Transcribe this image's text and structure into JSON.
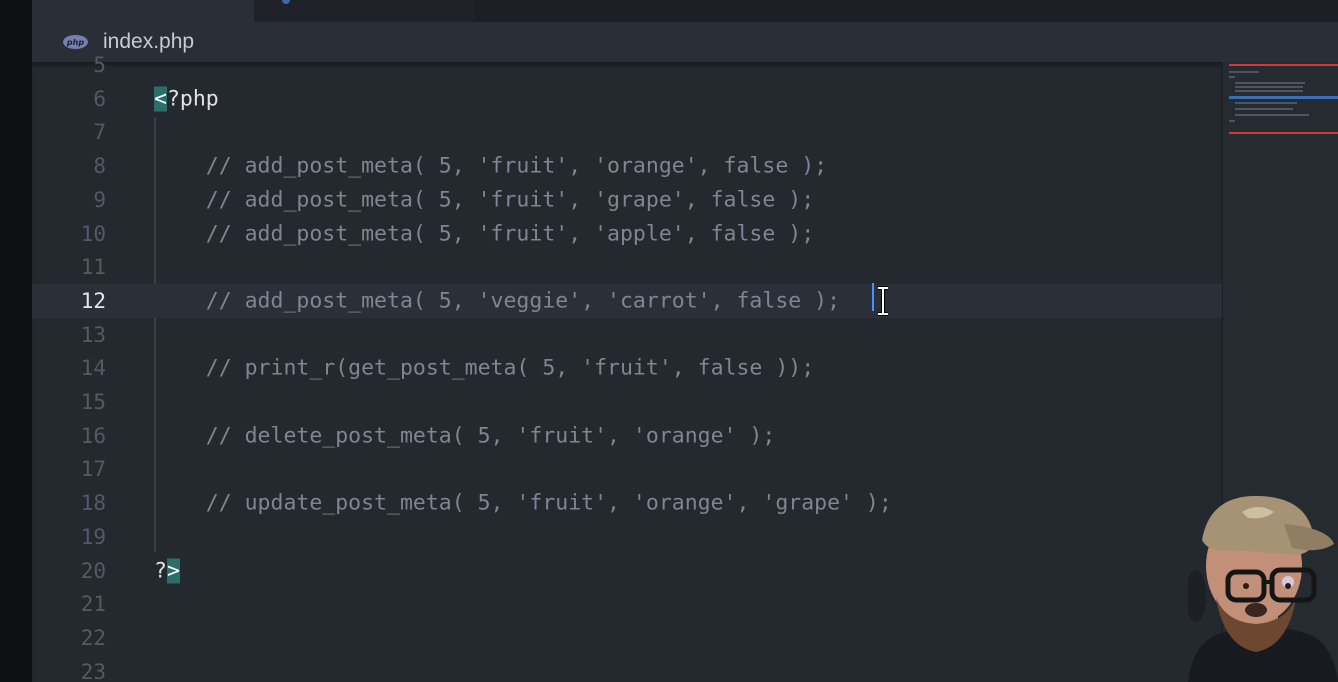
{
  "tab": {
    "file_name": "index.php",
    "file_icon": "php-icon",
    "icon_text": "php"
  },
  "editor": {
    "current_line": 12,
    "lines": [
      {
        "number": "5",
        "text": ""
      },
      {
        "number": "6",
        "text": "<?php"
      },
      {
        "number": "7",
        "text": ""
      },
      {
        "number": "8",
        "text": "    // add_post_meta( 5, 'fruit', 'orange', false );"
      },
      {
        "number": "9",
        "text": "    // add_post_meta( 5, 'fruit', 'grape', false );"
      },
      {
        "number": "10",
        "text": "    // add_post_meta( 5, 'fruit', 'apple', false );"
      },
      {
        "number": "11",
        "text": ""
      },
      {
        "number": "12",
        "text": "    // add_post_meta( 5, 'veggie', 'carrot', false );"
      },
      {
        "number": "13",
        "text": ""
      },
      {
        "number": "14",
        "text": "    // print_r(get_post_meta( 5, 'fruit', false ));"
      },
      {
        "number": "15",
        "text": ""
      },
      {
        "number": "16",
        "text": "    // delete_post_meta( 5, 'fruit', 'orange' );"
      },
      {
        "number": "17",
        "text": ""
      },
      {
        "number": "18",
        "text": "    // update_post_meta( 5, 'fruit', 'orange', 'grape' );"
      },
      {
        "number": "19",
        "text": ""
      },
      {
        "number": "20",
        "text": "?>"
      },
      {
        "number": "21",
        "text": ""
      },
      {
        "number": "22",
        "text": ""
      },
      {
        "number": "23",
        "text": ""
      }
    ]
  },
  "colors": {
    "background": "#24282f",
    "comment": "#7f8691",
    "tag_highlight": "#2b6f6a",
    "cursor": "#4a8eff"
  }
}
